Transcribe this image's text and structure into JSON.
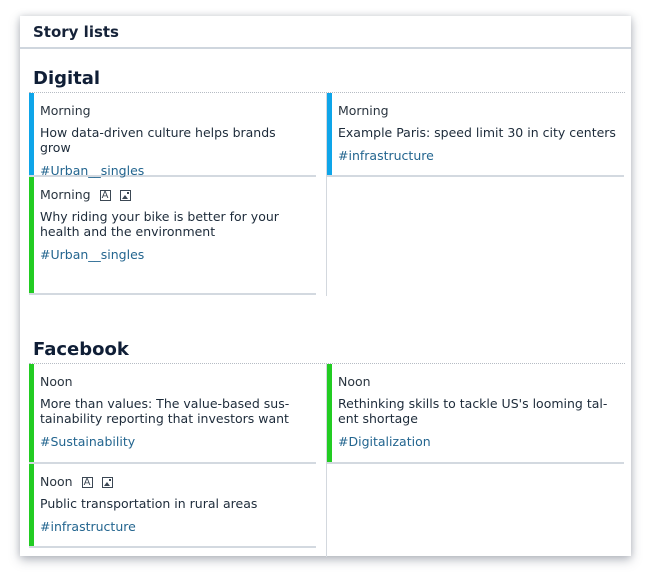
{
  "panel": {
    "title": "Story lists"
  },
  "colors": {
    "morning": "#0ea5e9",
    "noon": "#22cc22",
    "tag": "#23658f"
  },
  "sections": [
    {
      "title": "Digital",
      "left": [
        {
          "slot": "Morning",
          "headline": "How data-driven culture helps brands grow",
          "tag": "#Urban__singles",
          "bar": "morning",
          "icons": []
        },
        {
          "slot": "Morning",
          "headline": "Why riding your bike is better for your health and the environment",
          "tag": "#Urban__singles",
          "bar": "noon",
          "icons": [
            "text-icon",
            "image-icon"
          ]
        }
      ],
      "right": [
        {
          "slot": "Morning",
          "headline": "Example Paris: speed limit 30 in city centers",
          "tag": "#infrastructure",
          "bar": "morning",
          "icons": []
        }
      ]
    },
    {
      "title": "Facebook",
      "left": [
        {
          "slot": "Noon",
          "headline": "More than values: The value-based sus-tainability reporting that investors want",
          "tag": "#Sustainability",
          "bar": "noon",
          "icons": []
        },
        {
          "slot": "Noon",
          "headline": "Public transportation in rural areas",
          "tag": "#infrastructure",
          "bar": "noon",
          "icons": [
            "text-icon",
            "image-icon"
          ]
        }
      ],
      "right": [
        {
          "slot": "Noon",
          "headline": "Rethinking skills to tackle US's looming tal-ent shortage",
          "tag": "#Digitalization",
          "bar": "noon",
          "icons": []
        }
      ]
    }
  ]
}
